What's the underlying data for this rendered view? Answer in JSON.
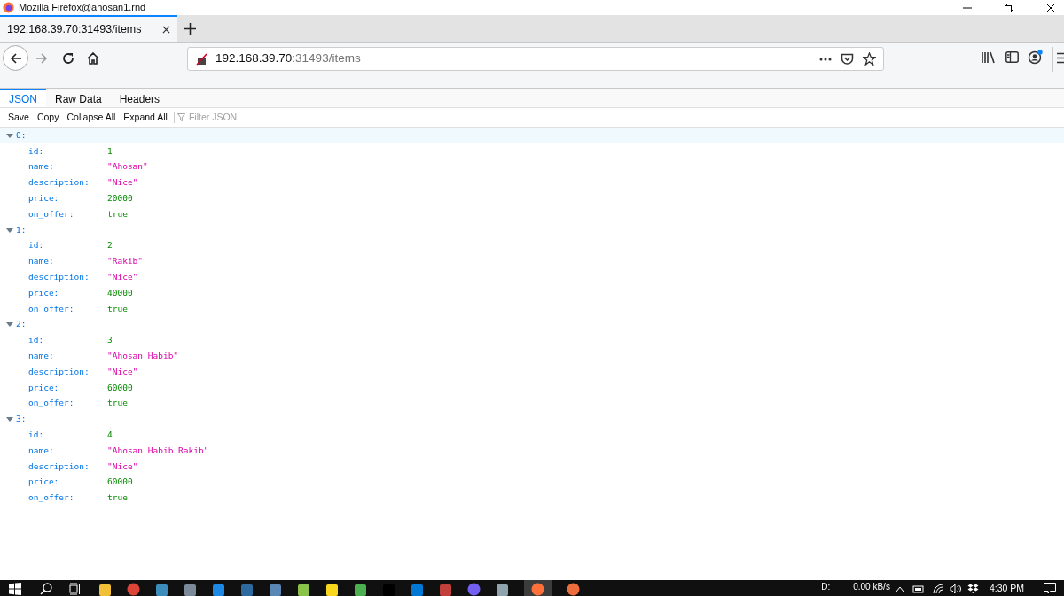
{
  "window": {
    "title": "Mozilla Firefox@ahosan1.rnd"
  },
  "browser_tabs": [
    {
      "label": "192.168.39.70:31493/items",
      "selected": true
    }
  ],
  "address_bar": {
    "host": "192.168.39.70",
    "path": ":31493/items"
  },
  "viewer_tabs": [
    {
      "label": "JSON",
      "selected": true
    },
    {
      "label": "Raw Data",
      "selected": false
    },
    {
      "label": "Headers",
      "selected": false
    }
  ],
  "toolbar": {
    "buttons": [
      "Save",
      "Copy",
      "Collapse All",
      "Expand All"
    ],
    "filter_placeholder": "Filter JSON"
  },
  "items": [
    {
      "index": "0:",
      "expanded": true,
      "selected": true,
      "fields": [
        {
          "key": "id:",
          "value": "1",
          "kind": "number"
        },
        {
          "key": "name:",
          "value": "\"Ahosan\"",
          "kind": "string"
        },
        {
          "key": "description:",
          "value": "\"Nice\"",
          "kind": "string"
        },
        {
          "key": "price:",
          "value": "20000",
          "kind": "number"
        },
        {
          "key": "on_offer:",
          "value": "true",
          "kind": "boolean"
        }
      ]
    },
    {
      "index": "1:",
      "expanded": true,
      "selected": false,
      "fields": [
        {
          "key": "id:",
          "value": "2",
          "kind": "number"
        },
        {
          "key": "name:",
          "value": "\"Rakib\"",
          "kind": "string"
        },
        {
          "key": "description:",
          "value": "\"Nice\"",
          "kind": "string"
        },
        {
          "key": "price:",
          "value": "40000",
          "kind": "number"
        },
        {
          "key": "on_offer:",
          "value": "true",
          "kind": "boolean"
        }
      ]
    },
    {
      "index": "2:",
      "expanded": true,
      "selected": false,
      "fields": [
        {
          "key": "id:",
          "value": "3",
          "kind": "number"
        },
        {
          "key": "name:",
          "value": "\"Ahosan Habib\"",
          "kind": "string"
        },
        {
          "key": "description:",
          "value": "\"Nice\"",
          "kind": "string"
        },
        {
          "key": "price:",
          "value": "60000",
          "kind": "number"
        },
        {
          "key": "on_offer:",
          "value": "true",
          "kind": "boolean"
        }
      ]
    },
    {
      "index": "3:",
      "expanded": true,
      "selected": false,
      "fields": [
        {
          "key": "id:",
          "value": "4",
          "kind": "number"
        },
        {
          "key": "name:",
          "value": "\"Ahosan Habib Rakib\"",
          "kind": "string"
        },
        {
          "key": "description:",
          "value": "\"Nice\"",
          "kind": "string"
        },
        {
          "key": "price:",
          "value": "60000",
          "kind": "number"
        },
        {
          "key": "on_offer:",
          "value": "true",
          "kind": "boolean"
        }
      ]
    }
  ],
  "taskbar": {
    "drive": "D:",
    "net_speed": "0.00 kB/s",
    "clock": "4:30 PM"
  }
}
